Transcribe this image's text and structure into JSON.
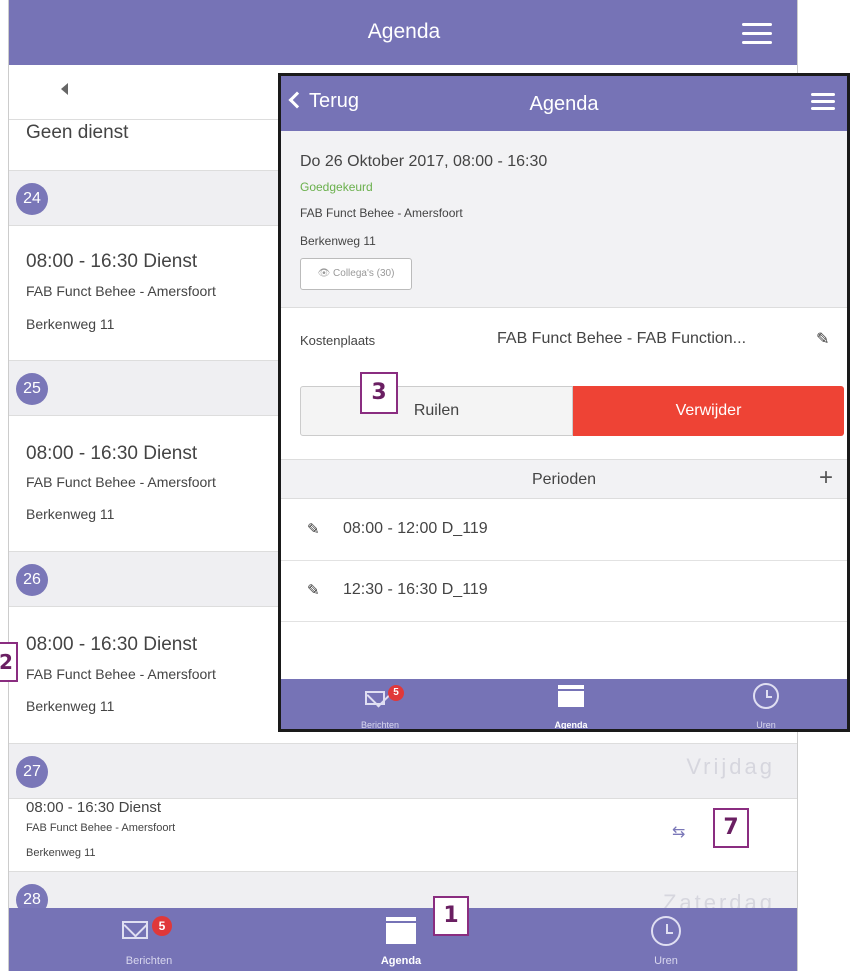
{
  "background_app": {
    "title": "Agenda",
    "no_service_text": "Geen dienst",
    "days": [
      {
        "date": "24",
        "time": "08:00 - 16:30 Dienst",
        "location": "FAB Funct Behee - Amersfoort",
        "address": "Berkenweg 11"
      },
      {
        "date": "25",
        "time": "08:00 - 16:30 Dienst",
        "location": "FAB Funct Behee - Amersfoort",
        "address": "Berkenweg 11"
      },
      {
        "date": "26",
        "time": "08:00 - 16:30 Dienst",
        "location": "FAB Funct Behee - Amersfoort",
        "address": "Berkenweg 11"
      },
      {
        "date": "27",
        "weekday": "Vrijdag",
        "time": "08:00 - 16:30 Dienst",
        "location": "FAB Funct Behee - Amersfoort",
        "address": "Berkenweg 11"
      },
      {
        "date": "28",
        "weekday": "Zaterdag"
      }
    ],
    "tabs": {
      "messages": {
        "label": "Berichten",
        "badge": "5",
        "icon": "envelope-icon"
      },
      "agenda": {
        "label": "Agenda",
        "icon": "calendar-icon",
        "active": true
      },
      "hours": {
        "label": "Uren",
        "icon": "clock-icon"
      }
    }
  },
  "overlay": {
    "back_label": "Terug",
    "title": "Agenda",
    "date_line": "Do 26 Oktober 2017, 08:00 - 16:30",
    "status": "Goedgekeurd",
    "status_color": "#6ab04c",
    "location": "FAB Funct Behee - Amersfoort",
    "address": "Berkenweg 11",
    "colleagues_label": "Collega's (30)",
    "cost_label": "Kostenplaats",
    "cost_value": "FAB Funct Behee - FAB Function...",
    "swap_button": "Ruilen",
    "delete_button": "Verwijder",
    "delete_color": "#ee4335",
    "periods_title": "Perioden",
    "periods": [
      {
        "label": "08:00 - 12:00 D_119"
      },
      {
        "label": "12:30 - 16:30 D_119"
      }
    ],
    "tabs": {
      "messages": {
        "label": "Berichten",
        "badge": "5"
      },
      "agenda": {
        "label": "Agenda",
        "active": true
      },
      "hours": {
        "label": "Uren"
      }
    }
  },
  "callouts": [
    "1",
    "2",
    "3",
    "7"
  ],
  "theme": {
    "primary": "#7673b6",
    "badge": "#e0383a"
  }
}
